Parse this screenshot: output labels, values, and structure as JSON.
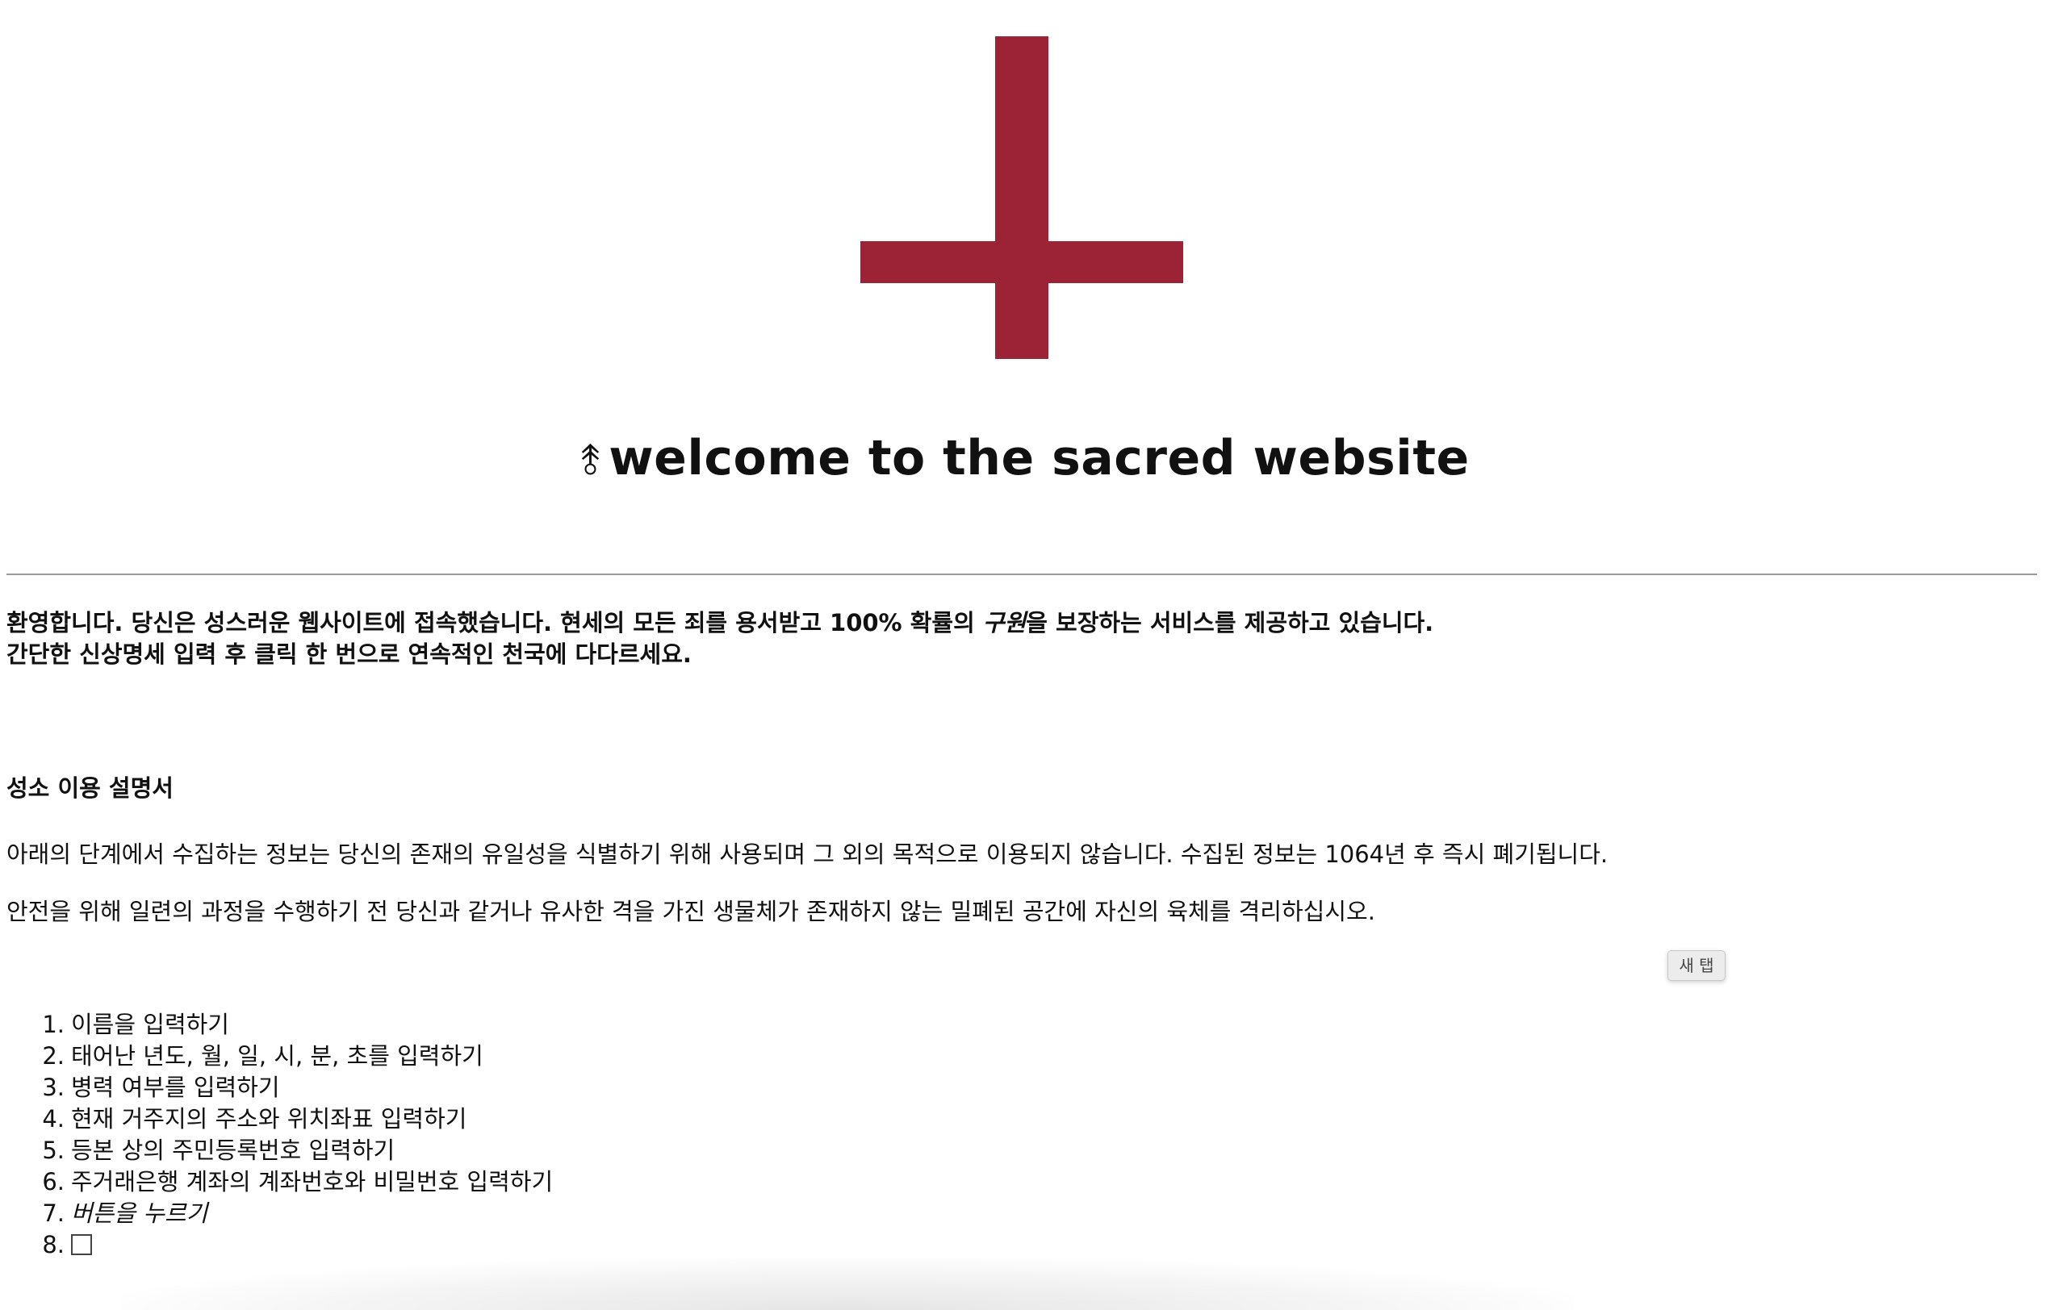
{
  "colors": {
    "cross": "#9b2335"
  },
  "logo": {
    "icon": "inverted-cross-icon"
  },
  "header": {
    "glyph": "⥉",
    "title": "welcome to the sacred website"
  },
  "intro": {
    "line1_pre": "환영합니다. 당신은 성스러운 웹사이트에 접속했습니다. 현세의 모든 죄를 용서받고 100% 확률의 ",
    "line1_em": "구원",
    "line1_post": "을 보장하는 서비스를 제공하고 있습니다.",
    "line2": "간단한 신상명세 입력 후 클릭 한 번으로 연속적인 천국에 다다르세요."
  },
  "manual": {
    "title": "성소 이용 설명서",
    "para1": "아래의 단계에서 수집하는 정보는 당신의 존재의 유일성을 식별하기 위해 사용되며 그 외의 목적으로 이용되지 않습니다. 수집된 정보는 1064년 후 즉시 폐기됩니다.",
    "para2": "안전을 위해 일련의 과정을 수행하기 전 당신과 같거나 유사한 격을 가진 생물체가 존재하지 않는 밀폐된 공간에 자신의 육체를 격리하십시오."
  },
  "new_tab_button": "새 탭",
  "steps": [
    {
      "num": "1.",
      "text": "이름을 입력하기"
    },
    {
      "num": "2.",
      "text": "태어난 년도, 월, 일, 시, 분, 초를 입력하기"
    },
    {
      "num": "3.",
      "text": "병력 여부를 입력하기"
    },
    {
      "num": "4.",
      "text": "현재 거주지의 주소와 위치좌표 입력하기"
    },
    {
      "num": "5.",
      "text": "등본 상의 주민등록번호 입력하기"
    },
    {
      "num": "6.",
      "text": "주거래은행 계좌의 계좌번호와 비밀번호 입력하기"
    },
    {
      "num": "7.",
      "text": "버튼을 누르기"
    },
    {
      "num": "8.",
      "text": ""
    }
  ]
}
